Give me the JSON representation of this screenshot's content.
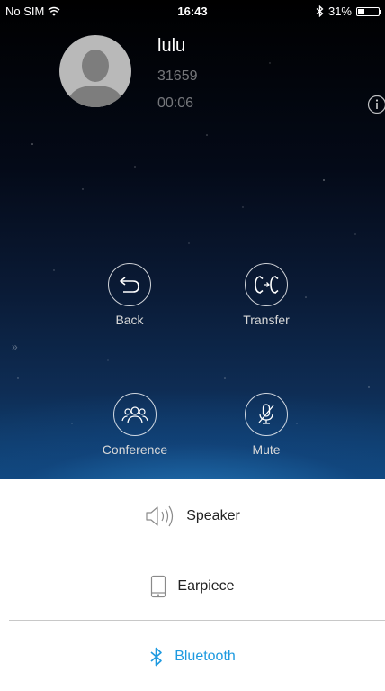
{
  "status_bar": {
    "carrier": "No SIM",
    "time": "16:43",
    "battery": "31%",
    "battery_level": 0.31
  },
  "caller": {
    "name": "lulu",
    "number": "31659",
    "duration": "00:06"
  },
  "controls": [
    {
      "label": "Back",
      "icon": "back-arrow-icon"
    },
    {
      "label": "Transfer",
      "icon": "transfer-icon"
    },
    {
      "label": "Conference",
      "icon": "conference-icon"
    },
    {
      "label": "Mute",
      "icon": "mute-icon"
    }
  ],
  "audio_options": [
    {
      "label": "Speaker",
      "icon": "speaker-icon",
      "selected": false
    },
    {
      "label": "Earpiece",
      "icon": "earpiece-icon",
      "selected": false
    },
    {
      "label": "Bluetooth",
      "icon": "bluetooth-icon",
      "selected": true
    }
  ],
  "colors": {
    "accent": "#1e9ae0",
    "background_bottom": "#0f4a80",
    "panel": "#ffffff"
  }
}
